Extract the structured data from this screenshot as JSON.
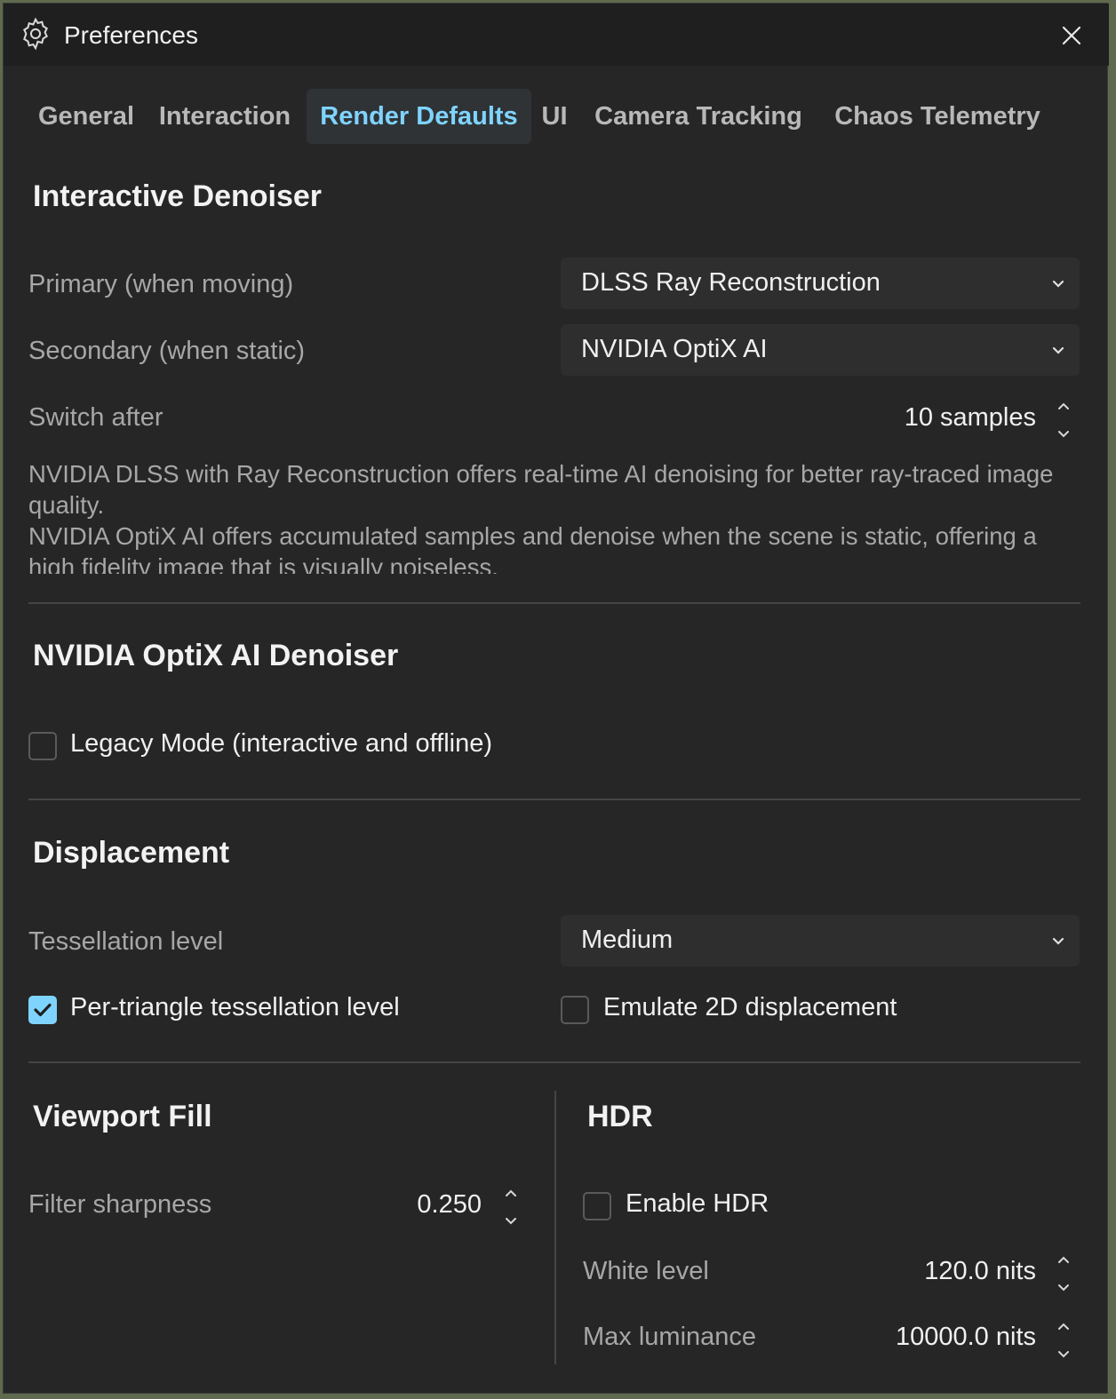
{
  "window": {
    "title": "Preferences",
    "title_icon": "gear-icon",
    "close_icon": "close-icon"
  },
  "tabs": [
    {
      "label": "General",
      "active": false
    },
    {
      "label": "Interaction",
      "active": false
    },
    {
      "label": "Render Defaults",
      "active": true
    },
    {
      "label": "UI",
      "active": false
    },
    {
      "label": "Camera Tracking",
      "active": false
    },
    {
      "label": "Chaos Telemetry",
      "active": false
    }
  ],
  "interactive_denoiser": {
    "title": "Interactive Denoiser",
    "primary": {
      "label": "Primary (when moving)",
      "value": "DLSS Ray Reconstruction"
    },
    "secondary": {
      "label": "Secondary (when static)",
      "value": "NVIDIA OptiX AI"
    },
    "switch_after": {
      "label": "Switch after",
      "value": "10 samples"
    },
    "description_1": "NVIDIA DLSS with Ray Reconstruction offers real-time AI denoising for better ray-traced image quality.",
    "description_2": "NVIDIA OptiX AI offers accumulated samples and denoise when the scene is static, offering a high fidelity image that is visually noiseless."
  },
  "optix_denoiser": {
    "title": "NVIDIA OptiX AI Denoiser",
    "legacy_mode": {
      "label": "Legacy Mode (interactive and offline)",
      "checked": false
    }
  },
  "displacement": {
    "title": "Displacement",
    "tessellation": {
      "label": "Tessellation level",
      "value": "Medium"
    },
    "per_triangle": {
      "label": "Per-triangle tessellation level",
      "checked": true
    },
    "emulate_2d": {
      "label": "Emulate 2D displacement",
      "checked": false
    }
  },
  "viewport_fill": {
    "title": "Viewport Fill",
    "filter_sharpness": {
      "label": "Filter sharpness",
      "value": "0.250"
    }
  },
  "hdr": {
    "title": "HDR",
    "enable": {
      "label": "Enable HDR",
      "checked": false
    },
    "white_level": {
      "label": "White level",
      "value": "120.0 nits"
    },
    "max_luminance": {
      "label": "Max luminance",
      "value": "10000.0 nits"
    }
  },
  "colors": {
    "accent": "#7fd4ff",
    "background": "#262626",
    "titlebar": "#1f1f1f"
  }
}
